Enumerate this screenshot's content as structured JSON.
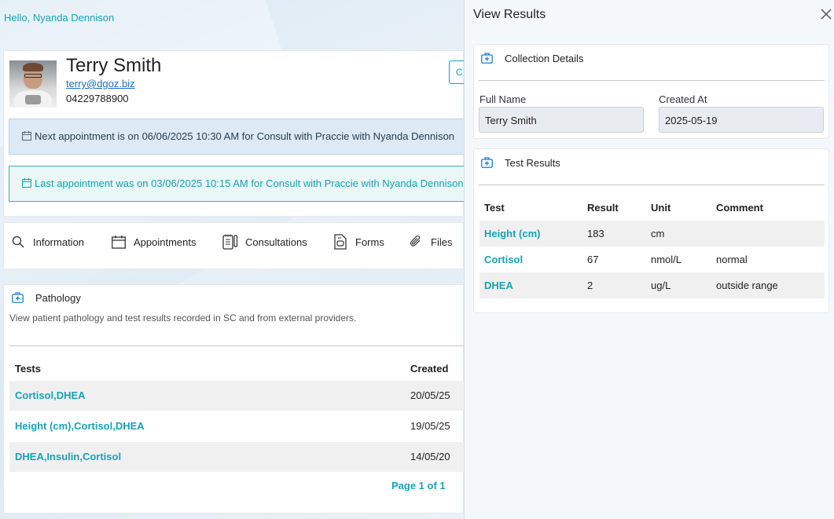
{
  "greeting": "Hello, Nyanda Dennison",
  "patient": {
    "name": "Terry Smith",
    "email": "terry@dgoz.biz",
    "phone": "04229788900",
    "edge_button": "C"
  },
  "alerts": {
    "next": "Next appointment is on 06/06/2025 10:30 AM for Consult with Praccie with Nyanda Dennison",
    "last": "Last appointment was on 03/06/2025 10:15 AM for Consult with Praccie with Nyanda Dennison"
  },
  "tabs": [
    {
      "label": "Information",
      "icon": "search-icon"
    },
    {
      "label": "Appointments",
      "icon": "calendar-icon"
    },
    {
      "label": "Consultations",
      "icon": "notes-icon"
    },
    {
      "label": "Forms",
      "icon": "form-icon"
    },
    {
      "label": "Files",
      "icon": "paperclip-icon"
    }
  ],
  "pathology": {
    "title": "Pathology",
    "description": "View patient pathology and test results recorded in SC and from external providers.",
    "columns": {
      "tests": "Tests",
      "created": "Created"
    },
    "rows": [
      {
        "tests": "Cortisol,DHEA",
        "created": "20/05/25"
      },
      {
        "tests": "Height (cm),Cortisol,DHEA",
        "created": "19/05/25"
      },
      {
        "tests": "DHEA,Insulin,Cortisol",
        "created": "14/05/20"
      }
    ],
    "pager": "Page 1 of 1"
  },
  "panel": {
    "title": "View Results",
    "collection": {
      "title": "Collection Details",
      "full_name_label": "Full Name",
      "full_name": "Terry Smith",
      "created_at_label": "Created At",
      "created_at": "2025-05-19"
    },
    "results": {
      "title": "Test Results",
      "columns": {
        "test": "Test",
        "result": "Result",
        "unit": "Unit",
        "comment": "Comment"
      },
      "rows": [
        {
          "test": "Height (cm)",
          "result": "183",
          "unit": "cm",
          "comment": ""
        },
        {
          "test": "Cortisol",
          "result": "67",
          "unit": "nmol/L",
          "comment": "normal"
        },
        {
          "test": "DHEA",
          "result": "2",
          "unit": "ug/L",
          "comment": "outside range"
        }
      ]
    }
  },
  "colors": {
    "accent": "#17a2b8",
    "link": "#1b6fc8",
    "next_alert_bg": "#dde9f4",
    "last_alert_bg": "#e9f7f6"
  }
}
